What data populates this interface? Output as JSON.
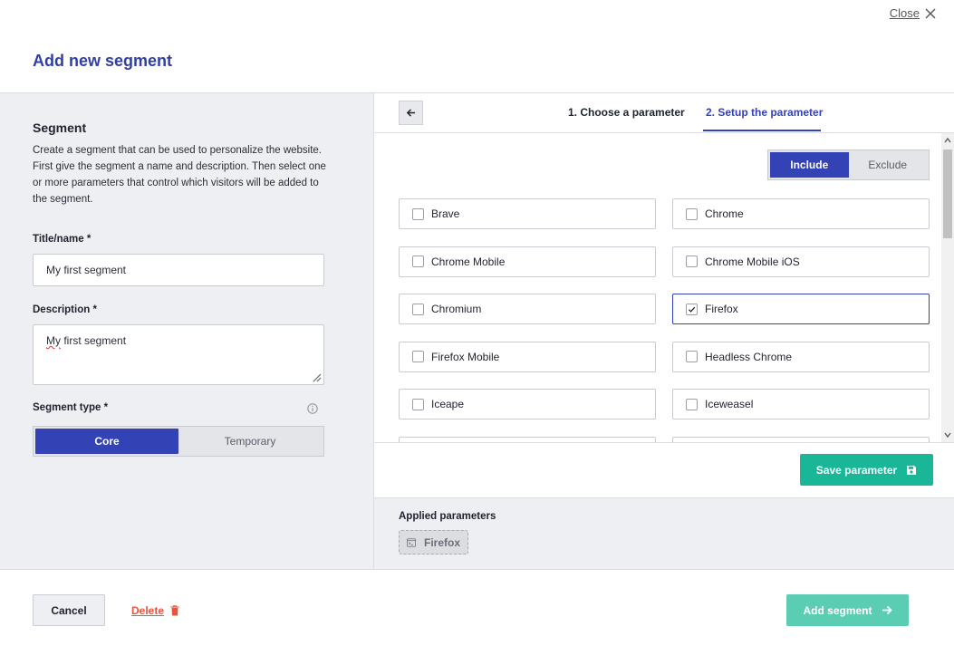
{
  "header": {
    "close_label": "Close",
    "title": "Add new segment"
  },
  "segment": {
    "section_title": "Segment",
    "description": "Create a segment that can be used to personalize the website. First give the segment a name and description. Then select one or more parameters that control which visitors will be added to the segment.",
    "title_label": "Title/name *",
    "title_value": "My first segment",
    "description_label": "Description *",
    "description_value_word1": "My",
    "description_value_rest": " first segment",
    "type_label": "Segment type *",
    "type_options": [
      "Core",
      "Temporary"
    ],
    "type_selected": "Core"
  },
  "steps": {
    "step1": "1. Choose a parameter",
    "step2": "2. Setup the parameter",
    "active": "2. Setup the parameter"
  },
  "parameter": {
    "mode_options": [
      "Include",
      "Exclude"
    ],
    "mode_selected": "Include",
    "options": [
      {
        "label": "Brave",
        "checked": false
      },
      {
        "label": "Chrome",
        "checked": false
      },
      {
        "label": "Chrome Mobile",
        "checked": false
      },
      {
        "label": "Chrome Mobile iOS",
        "checked": false
      },
      {
        "label": "Chromium",
        "checked": false
      },
      {
        "label": "Firefox",
        "checked": true
      },
      {
        "label": "Firefox Mobile",
        "checked": false
      },
      {
        "label": "Headless Chrome",
        "checked": false
      },
      {
        "label": "Iceape",
        "checked": false
      },
      {
        "label": "Iceweasel",
        "checked": false
      }
    ],
    "save_label": "Save parameter"
  },
  "applied": {
    "title": "Applied parameters",
    "chips": [
      "Firefox"
    ]
  },
  "footer": {
    "cancel_label": "Cancel",
    "delete_label": "Delete",
    "add_label": "Add segment"
  },
  "colors": {
    "primary": "#3343b5",
    "accent_green": "#19b797",
    "accent_green_light": "#5bcdb3",
    "danger": "#e8553d"
  }
}
